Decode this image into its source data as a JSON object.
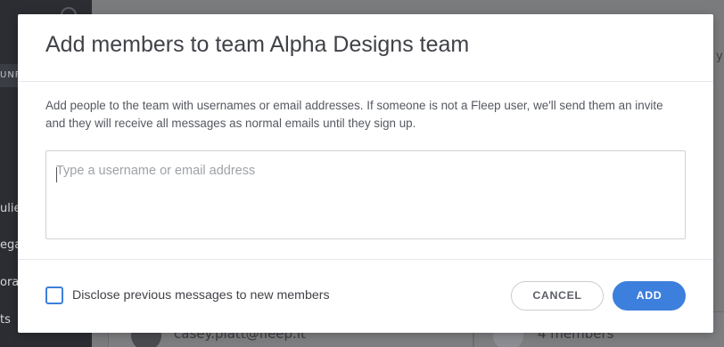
{
  "background": {
    "sidebar_header": "UNF",
    "sidebar_items": [
      "ulie",
      "ega",
      "ora",
      "ts"
    ],
    "card_email": "casey.platt@fleep.it",
    "card_members": "4 members",
    "edge_text": "y"
  },
  "modal": {
    "title": "Add members to team Alpha Designs team",
    "description": "Add people to the team with usernames or email addresses. If someone is not a Fleep user, we'll send them an invite and they will receive all messages as normal emails until they sign up.",
    "input": {
      "placeholder": "Type a username or email address",
      "value": ""
    },
    "disclose_checkbox": {
      "label": "Disclose previous messages to new members",
      "checked": false
    },
    "cancel_label": "CANCEL",
    "add_label": "ADD"
  },
  "colors": {
    "accent": "#3d7fdc",
    "title_text": "#404247",
    "overlay": "#6f6f71"
  }
}
